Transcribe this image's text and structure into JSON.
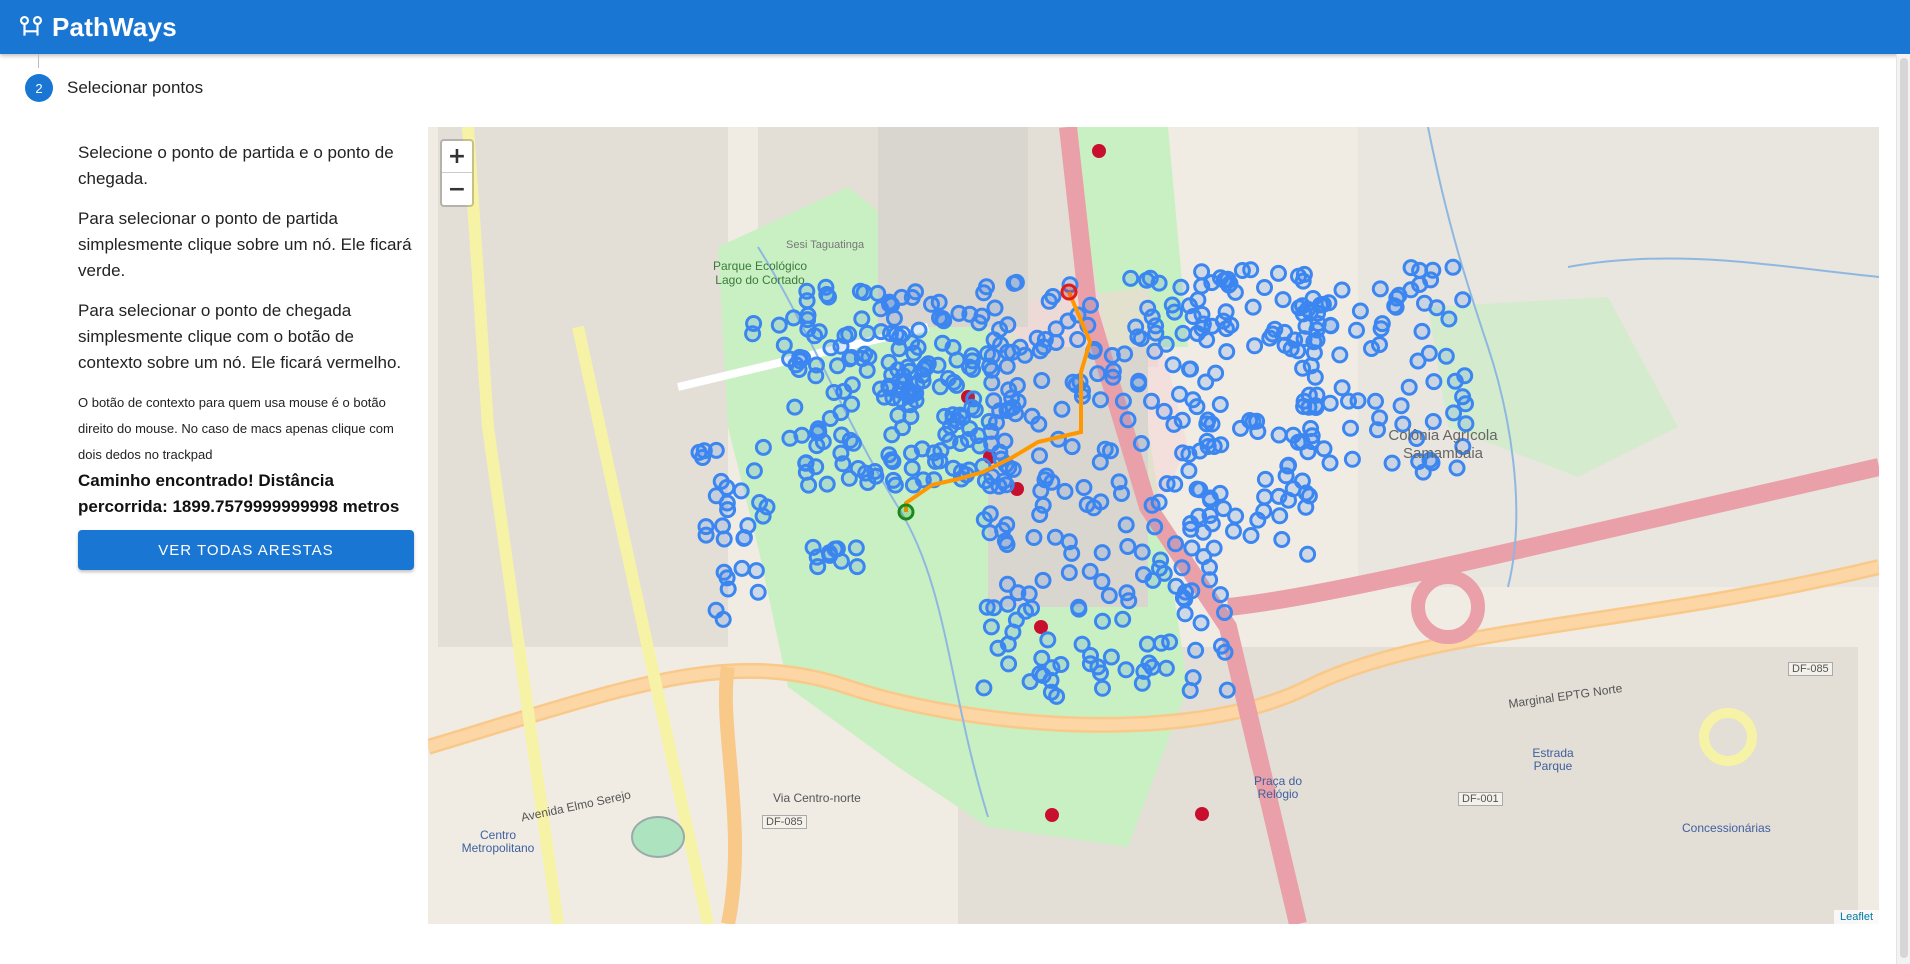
{
  "app": {
    "title": "PathWays",
    "logo_icon": "route-icon",
    "accent": "#1976d2"
  },
  "step": {
    "number": "2",
    "label": "Selecionar pontos"
  },
  "instructions": {
    "p1": "Selecione o ponto de partida e o ponto de chegada.",
    "p2": "Para selecionar o ponto de partida simplesmente clique sobre um nó. Ele ficará verde.",
    "p3": "Para selecionar o ponto de chegada simplesmente clique com o botão de contexto sobre um nó. Ele ficará vermelho.",
    "note": "O botão de contexto para quem usa mouse é o botão direito do mouse. No caso de macs apenas clique com dois dedos no trackpad",
    "result": "Caminho encontrado! Distância percorrida: 1899.7579999999998 metros"
  },
  "actions": {
    "show_all_edges": "Ver todas arestas"
  },
  "map": {
    "zoom_in": "+",
    "zoom_out": "−",
    "attribution": "Leaflet",
    "labels": {
      "park": "Parque Ecológico Lago do Cortado",
      "colonia": "Colônia Agrícola Samambaia",
      "centro": "Centro Metropolitano",
      "praca": "Praça do Relógio",
      "estrada_parque": "Estrada Parque",
      "concessionarias": "Concessionárias",
      "sesi": "Sesi Taguatinga",
      "df085": "DF-085",
      "df001": "DF-001",
      "elmo": "Avenida Elmo Serejo",
      "marginal": "Marginal EPTG Norte",
      "via_centro": "Via Centro-norte"
    },
    "node_color": "#3b86f0",
    "path_color": "#ff9800",
    "start_color": "#1b8a1b",
    "end_color": "#e01b1b"
  }
}
